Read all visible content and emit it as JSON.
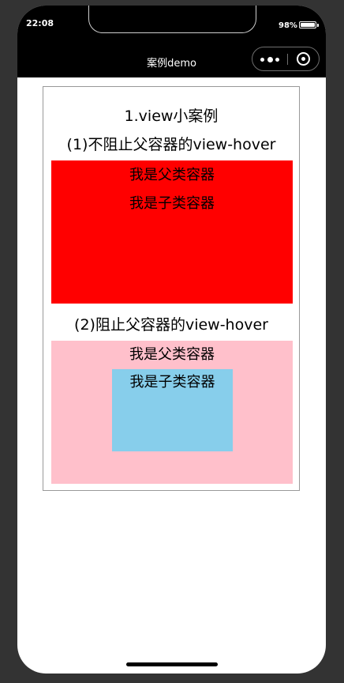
{
  "status_bar": {
    "time": "22:08",
    "battery_text": "98%",
    "battery_level": 0.98
  },
  "nav": {
    "title": "案例demo",
    "more_icon": "more-dots-icon",
    "close_icon": "target-circle-icon"
  },
  "content": {
    "title": "1.view小案例",
    "section1": {
      "heading": "(1)不阻止父容器的view-hover",
      "parent_label": "我是父类容器",
      "child_label": "我是子类容器",
      "parent_color": "#ff0000"
    },
    "section2": {
      "heading": "(2)阻止父容器的view-hover",
      "parent_label": "我是父类容器",
      "child_label": "我是子类容器",
      "parent_color": "#ffc0cb",
      "child_color": "#87ceeb"
    }
  }
}
